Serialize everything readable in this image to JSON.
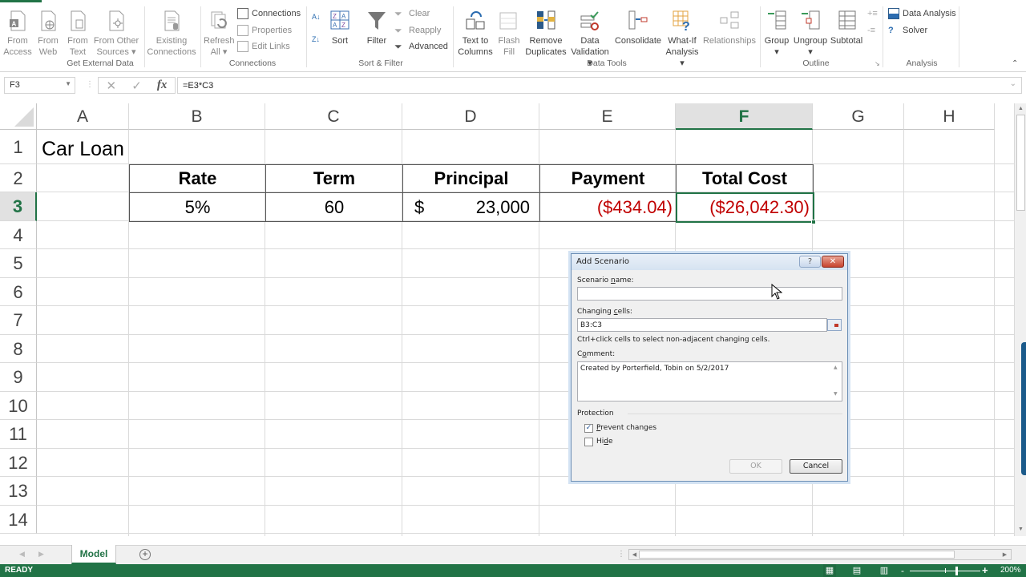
{
  "ribbon": {
    "groups": {
      "get_external_data": {
        "label": "Get External Data",
        "buttons": [
          {
            "label1": "From",
            "label2": "Access",
            "icon": "access-icon"
          },
          {
            "label1": "From",
            "label2": "Web",
            "icon": "web-icon"
          },
          {
            "label1": "From",
            "label2": "Text",
            "icon": "text-file-icon"
          },
          {
            "label1": "From Other",
            "label2": "Sources ▾",
            "icon": "other-sources-icon"
          },
          {
            "label1": "Existing",
            "label2": "Connections",
            "icon": "existing-connections-icon"
          }
        ]
      },
      "connections": {
        "label": "Connections",
        "refresh": {
          "label1": "Refresh",
          "label2": "All ▾"
        },
        "small": [
          "Connections",
          "Properties",
          "Edit Links"
        ]
      },
      "sort_filter": {
        "label": "Sort & Filter",
        "sort": "Sort",
        "filter": "Filter",
        "small": [
          "Clear",
          "Reapply",
          "Advanced"
        ]
      },
      "data_tools": {
        "label": "Data Tools",
        "buttons": [
          {
            "label1": "Text to",
            "label2": "Columns"
          },
          {
            "label1": "Flash",
            "label2": "Fill"
          },
          {
            "label1": "Remove",
            "label2": "Duplicates"
          },
          {
            "label1": "Data",
            "label2": "Validation ▾"
          },
          {
            "label1": "Consolidate",
            "label2": ""
          },
          {
            "label1": "What-If",
            "label2": "Analysis ▾"
          },
          {
            "label1": "Relationships",
            "label2": ""
          }
        ]
      },
      "outline": {
        "label": "Outline",
        "buttons": [
          {
            "label1": "Group",
            "label2": "▾"
          },
          {
            "label1": "Ungroup",
            "label2": "▾"
          },
          {
            "label1": "Subtotal",
            "label2": ""
          }
        ]
      },
      "analysis": {
        "label": "Analysis",
        "small": [
          "Data Analysis",
          "Solver"
        ]
      }
    }
  },
  "formula_bar": {
    "name_box": "F3",
    "formula": "=E3*C3",
    "fx": "fx"
  },
  "sheet": {
    "columns": [
      "A",
      "B",
      "C",
      "D",
      "E",
      "F",
      "G",
      "H"
    ],
    "selected_column": "F",
    "rows": [
      "1",
      "2",
      "3",
      "4",
      "5",
      "6",
      "7",
      "8",
      "9",
      "10",
      "11",
      "12",
      "13",
      "14"
    ],
    "selected_row": "3",
    "title": "Car Loan",
    "headers": {
      "rate": "Rate",
      "term": "Term",
      "principal": "Principal",
      "payment": "Payment",
      "total_cost": "Total Cost"
    },
    "values": {
      "rate": "5%",
      "term": "60",
      "principal_symbol": "$",
      "principal": "23,000",
      "payment": "($434.04)",
      "total_cost": "($26,042.30)"
    },
    "negative_color": "#c00000"
  },
  "tabs": {
    "sheets": [
      "Model"
    ],
    "active": "Model",
    "add_label": "+"
  },
  "status_bar": {
    "mode": "READY",
    "zoom": "200%",
    "zoom_minus": "-",
    "zoom_plus": "+"
  },
  "dialog": {
    "title": "Add Scenario",
    "help": "?",
    "close": "✕",
    "scenario_name_label_pre": "Scenario ",
    "scenario_name_label_u": "n",
    "scenario_name_label_post": "ame:",
    "scenario_name_value": "",
    "changing_cells_label_pre": "Changing ",
    "changing_cells_label_u": "c",
    "changing_cells_label_post": "ells:",
    "changing_cells_value": "B3:C3",
    "hint": "Ctrl+click cells to select non-adjacent changing cells.",
    "comment_label_pre": "C",
    "comment_label_u": "o",
    "comment_label_post": "mment:",
    "comment_value": "Created by Porterfield, Tobin on 5/2/2017",
    "protection_label": "Protection",
    "prevent_changes_u": "P",
    "prevent_changes_rest": "revent changes",
    "prevent_changes_checked": true,
    "hide_pre": "Hi",
    "hide_u": "d",
    "hide_post": "e",
    "hide_checked": false,
    "ok": "OK",
    "cancel": "Cancel"
  },
  "colors": {
    "accent": "#217346",
    "negative": "#c00000"
  }
}
